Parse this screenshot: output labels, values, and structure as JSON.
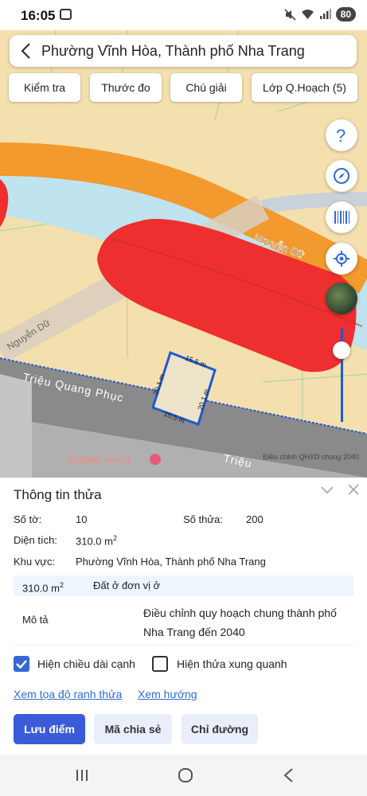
{
  "status": {
    "time": "16:05",
    "battery": "80"
  },
  "header": {
    "title": "Phường Vĩnh Hòa, Thành phố Nha Trang"
  },
  "toolbar": {
    "check": "Kiểm tra",
    "ruler": "Thước đo",
    "legend": "Chú giải",
    "layers": "Lớp Q.Hoạch (5)"
  },
  "map": {
    "street_nguyen_du_1": "Nguyễn Dữ",
    "street_nguyen_du_2": "Nguyễn Dữ",
    "street_trieu_quang_phuc": "Triệu Quang Phục",
    "street_trieu_partial": "Triệu",
    "poi": "Golden moon",
    "edge_top": "15.5 m",
    "edge_bottom": "15.5 m",
    "edge_left": "20.1 m",
    "edge_right": "20.1 m",
    "attribution": "Điều chỉnh QHXD chung 2040",
    "colors": {
      "residential": "#f4dfae",
      "river": "#bfe3ef",
      "road_orange": "#f29a2e",
      "red_zone": "#ee2f2f",
      "parcel": "#1e5ad1"
    }
  },
  "panel": {
    "title": "Thông tin thửa",
    "sheet_label": "Số tờ:",
    "sheet_value": "10",
    "parcel_label": "Số thửa:",
    "parcel_value": "200",
    "area_label": "Diện tích:",
    "area_value": "310.0 m",
    "area_sup": "2",
    "region_label": "Khu vực:",
    "region_value": "Phường Vĩnh Hòa, Thành phố Nha Trang",
    "table_area": "310.0 m",
    "table_area_sup": "2",
    "land_use": "Đất ở đơn vị ở",
    "desc_label": "Mô tả",
    "desc_value": "Điều chỉnh quy hoạch chung thành phố Nha Trang đến 2040",
    "show_edges": "Hiện chiều dài cạnh",
    "show_neighbors": "Hiện thửa xung quanh",
    "link_coords": "Xem tọa độ ranh thửa",
    "link_direction": "Xem hướng",
    "btn_save": "Lưu điểm",
    "btn_share": "Mã chia sẻ",
    "btn_directions": "Chỉ đường"
  }
}
